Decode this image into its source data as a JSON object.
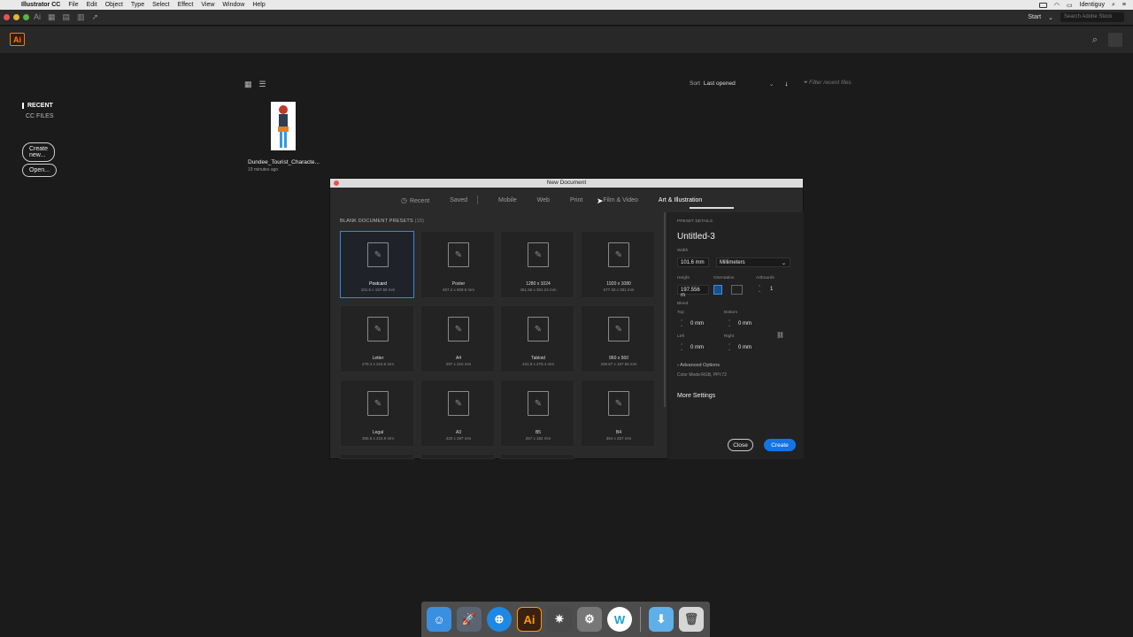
{
  "menubar": {
    "app_name": "Illustrator CC",
    "menus": [
      "File",
      "Edit",
      "Object",
      "Type",
      "Select",
      "Effect",
      "View",
      "Window",
      "Help"
    ],
    "user": "Identiguy"
  },
  "apptop": {
    "start_label": "Start",
    "search_placeholder": "Search Adobe Stock"
  },
  "appbar": {
    "logo": "Ai"
  },
  "left_panel": {
    "recent_label": "RECENT",
    "ccfiles_label": "CC FILES",
    "create_new": "Create new...",
    "open": "Open..."
  },
  "sort": {
    "label": "Sort",
    "value": "Last opened",
    "filter_placeholder": "Filter recent files"
  },
  "recent_files": [
    {
      "name": "Dundee_Tourist_Characte...",
      "time": "19 minutes ago"
    }
  ],
  "dialog": {
    "title": "New Document",
    "tabs": [
      "Recent",
      "Saved",
      "Mobile",
      "Web",
      "Print",
      "Film & Video",
      "Art & Illustration"
    ],
    "active_tab": "Art & Illustration",
    "presets_heading": "BLANK DOCUMENT PRESETS",
    "presets_count": "(15)",
    "presets": [
      {
        "name": "Postcard",
        "size": "101.6 x 197.56 mm"
      },
      {
        "name": "Poster",
        "size": "457.2 x 609.6 mm"
      },
      {
        "name": "1280 x 1024",
        "size": "451.56 x 361.24 mm"
      },
      {
        "name": "1920 x 1080",
        "size": "677.33 x 381 mm"
      },
      {
        "name": "Letter",
        "size": "279.4 x 215.9 mm"
      },
      {
        "name": "A4",
        "size": "297 x 210 mm"
      },
      {
        "name": "Tabloid",
        "size": "431.8 x 279.4 mm"
      },
      {
        "name": "960 x 560",
        "size": "338.67 x 197.56 mm"
      },
      {
        "name": "Legal",
        "size": "355.6 x 215.9 mm"
      },
      {
        "name": "A3",
        "size": "420 x 297 mm"
      },
      {
        "name": "B5",
        "size": "257 x 182 mm"
      },
      {
        "name": "B4",
        "size": "364 x 257 mm"
      }
    ],
    "details": {
      "heading": "PRESET DETAILS",
      "doc_name": "Untitled-3",
      "width_label": "Width",
      "width_value": "101.6 mm",
      "units": "Millimeters",
      "height_label": "Height",
      "height_value": "197.556 m",
      "orientation_label": "Orientation",
      "artboards_label": "Artboards",
      "artboards_value": "1",
      "bleed_label": "Bleed",
      "top_label": "Top",
      "top_value": "0 mm",
      "bottom_label": "Bottom",
      "bottom_value": "0 mm",
      "left_label": "Left",
      "left_value": "0 mm",
      "right_label": "Right",
      "right_value": "0 mm",
      "advanced": "Advanced Options",
      "color_mode": "Color Mode:RGB, PPI:72",
      "more_settings": "More Settings",
      "close": "Close",
      "create": "Create"
    }
  },
  "dock": {
    "ai_label": "Ai"
  }
}
